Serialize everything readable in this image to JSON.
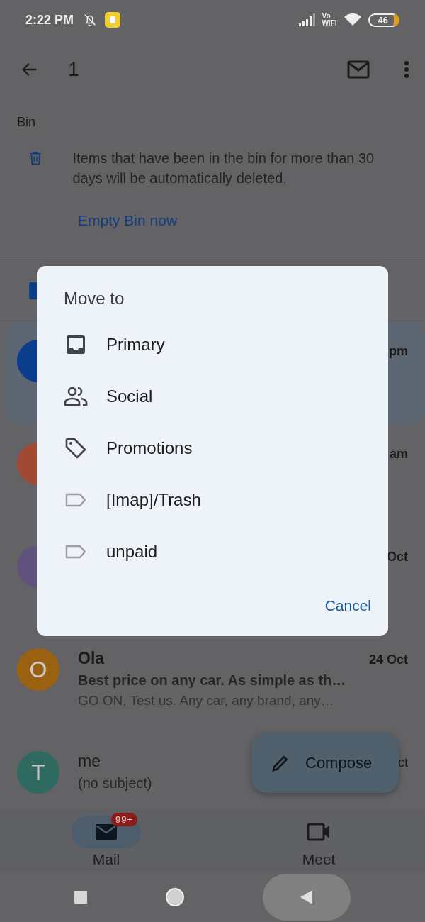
{
  "status_bar": {
    "time": "2:22 PM",
    "volte_top": "Vo",
    "volte_bottom": "WiFi",
    "battery": "46"
  },
  "toolbar": {
    "title": "1"
  },
  "banner": {
    "label": "Bin",
    "message": "Items that have been in the bin for more than 30 days will be automatically deleted.",
    "action": "Empty Bin now"
  },
  "messages": [
    {
      "time": "pm",
      "selected": true,
      "color": "#0b3d8c"
    },
    {
      "time": "am",
      "selected": false,
      "color": "#a04a33"
    },
    {
      "time": "Oct",
      "selected": false,
      "color": "#5f537e"
    },
    {
      "sender": "Ola",
      "time": "24 Oct",
      "subject": "Best price on any car. As simple as th…",
      "snippet": "GO ON, Test us. Any car, any brand, any…",
      "unread": true,
      "avatar_letter": "O",
      "selected": false,
      "color": "#9a6210"
    },
    {
      "sender": "me",
      "time": "ct",
      "subject": "(no subject)",
      "unread": false,
      "avatar_letter": "T",
      "selected": false,
      "color": "#2e6a5f"
    }
  ],
  "dialog": {
    "title": "Move to",
    "options": [
      {
        "label": "Primary",
        "kind": "inbox"
      },
      {
        "label": "Social",
        "kind": "people"
      },
      {
        "label": "Promotions",
        "kind": "tag"
      },
      {
        "label": "[Imap]/Trash",
        "kind": "label"
      },
      {
        "label": "unpaid",
        "kind": "label"
      }
    ],
    "cancel": "Cancel"
  },
  "compose": {
    "label": "Compose"
  },
  "bottom_nav": [
    {
      "label": "Mail",
      "kind": "mail",
      "selected": true,
      "badge": "99+"
    },
    {
      "label": "Meet",
      "kind": "video",
      "selected": false
    }
  ]
}
